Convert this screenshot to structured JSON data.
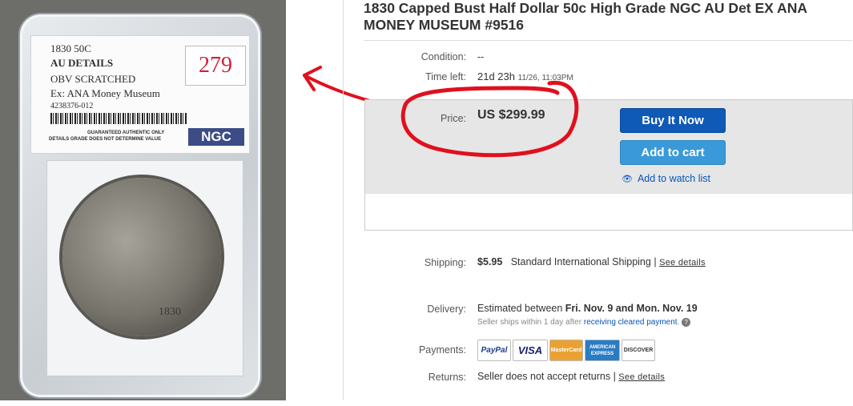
{
  "photo": {
    "label_line1": "1830  50C",
    "label_line2": "AU DETAILS",
    "label_line3": "OBV SCRATCHED",
    "label_line4": "Ex: ANA Money Museum",
    "label_line5": "4238376-012",
    "label_fine1": "GUARANTEED AUTHENTIC ONLY",
    "label_fine2": "DETAILS GRADE DOES NOT DETERMINE VALUE",
    "logo": "NGC",
    "handwritten_price": "279",
    "coin_date": "1830"
  },
  "listing": {
    "title": "1830 Capped Bust Half Dollar 50c High Grade NGC AU Det EX ANA MONEY MUSEUM #9516",
    "condition_label": "Condition:",
    "condition_value": "--",
    "time_left_label": "Time left:",
    "time_left_value": "21d 23h",
    "time_left_date": "11/26, 11:03PM",
    "price_label": "Price:",
    "price_value": "US $299.99",
    "buy_now": "Buy It Now",
    "add_to_cart": "Add to cart",
    "watch_list": "Add to watch list",
    "shipping_label": "Shipping:",
    "shipping_cost": "$5.95",
    "shipping_method": "Standard International Shipping",
    "sep": "|",
    "see_details": "See details",
    "delivery_label": "Delivery:",
    "delivery_text": "Estimated between",
    "delivery_start": "Fri. Nov. 9",
    "delivery_and": "and",
    "delivery_end": "Mon. Nov. 19",
    "delivery_sub": "Seller ships within 1 day after",
    "delivery_sub_link": "receiving cleared payment",
    "delivery_sub_end": ".",
    "payments_label": "Payments:",
    "payment_methods": [
      "PayPal",
      "VISA",
      "MasterCard",
      "AMERICAN EXPRESS",
      "DISCOVER"
    ],
    "returns_label": "Returns:",
    "returns_value": "Seller does not accept returns"
  },
  "colors": {
    "annotation_red": "#e0101e",
    "buy_blue": "#0f59b7",
    "cart_blue": "#3a9ad9",
    "link_blue": "#0654ba"
  }
}
